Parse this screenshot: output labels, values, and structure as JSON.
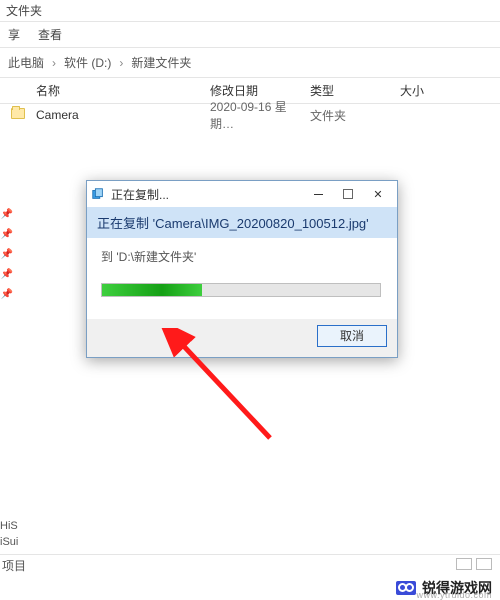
{
  "window": {
    "title_fragment": "文件夹"
  },
  "ribbon": {
    "share": "享",
    "view": "查看"
  },
  "breadcrumb": {
    "root": "此电脑",
    "drive": "软件 (D:)",
    "folder": "新建文件夹"
  },
  "columns": {
    "name": "名称",
    "date": "修改日期",
    "type": "类型",
    "size": "大小"
  },
  "rows": [
    {
      "name": "Camera",
      "date": "2020-09-16 星期…",
      "type": "文件夹"
    }
  ],
  "sidebar_suffixes": [
    "HiS",
    "iSui"
  ],
  "status": {
    "footer": "项目"
  },
  "dialog": {
    "title": "正在复制...",
    "banner_prefix": "正在复制",
    "banner_path": "'Camera\\IMG_20200820_100512.jpg'",
    "dest_prefix": "到",
    "dest_path": "'D:\\新建文件夹'",
    "progress_percent": 36,
    "cancel": "取消"
  },
  "watermark": {
    "brand": "锐得游戏网",
    "url": "www.ytruido.com"
  }
}
